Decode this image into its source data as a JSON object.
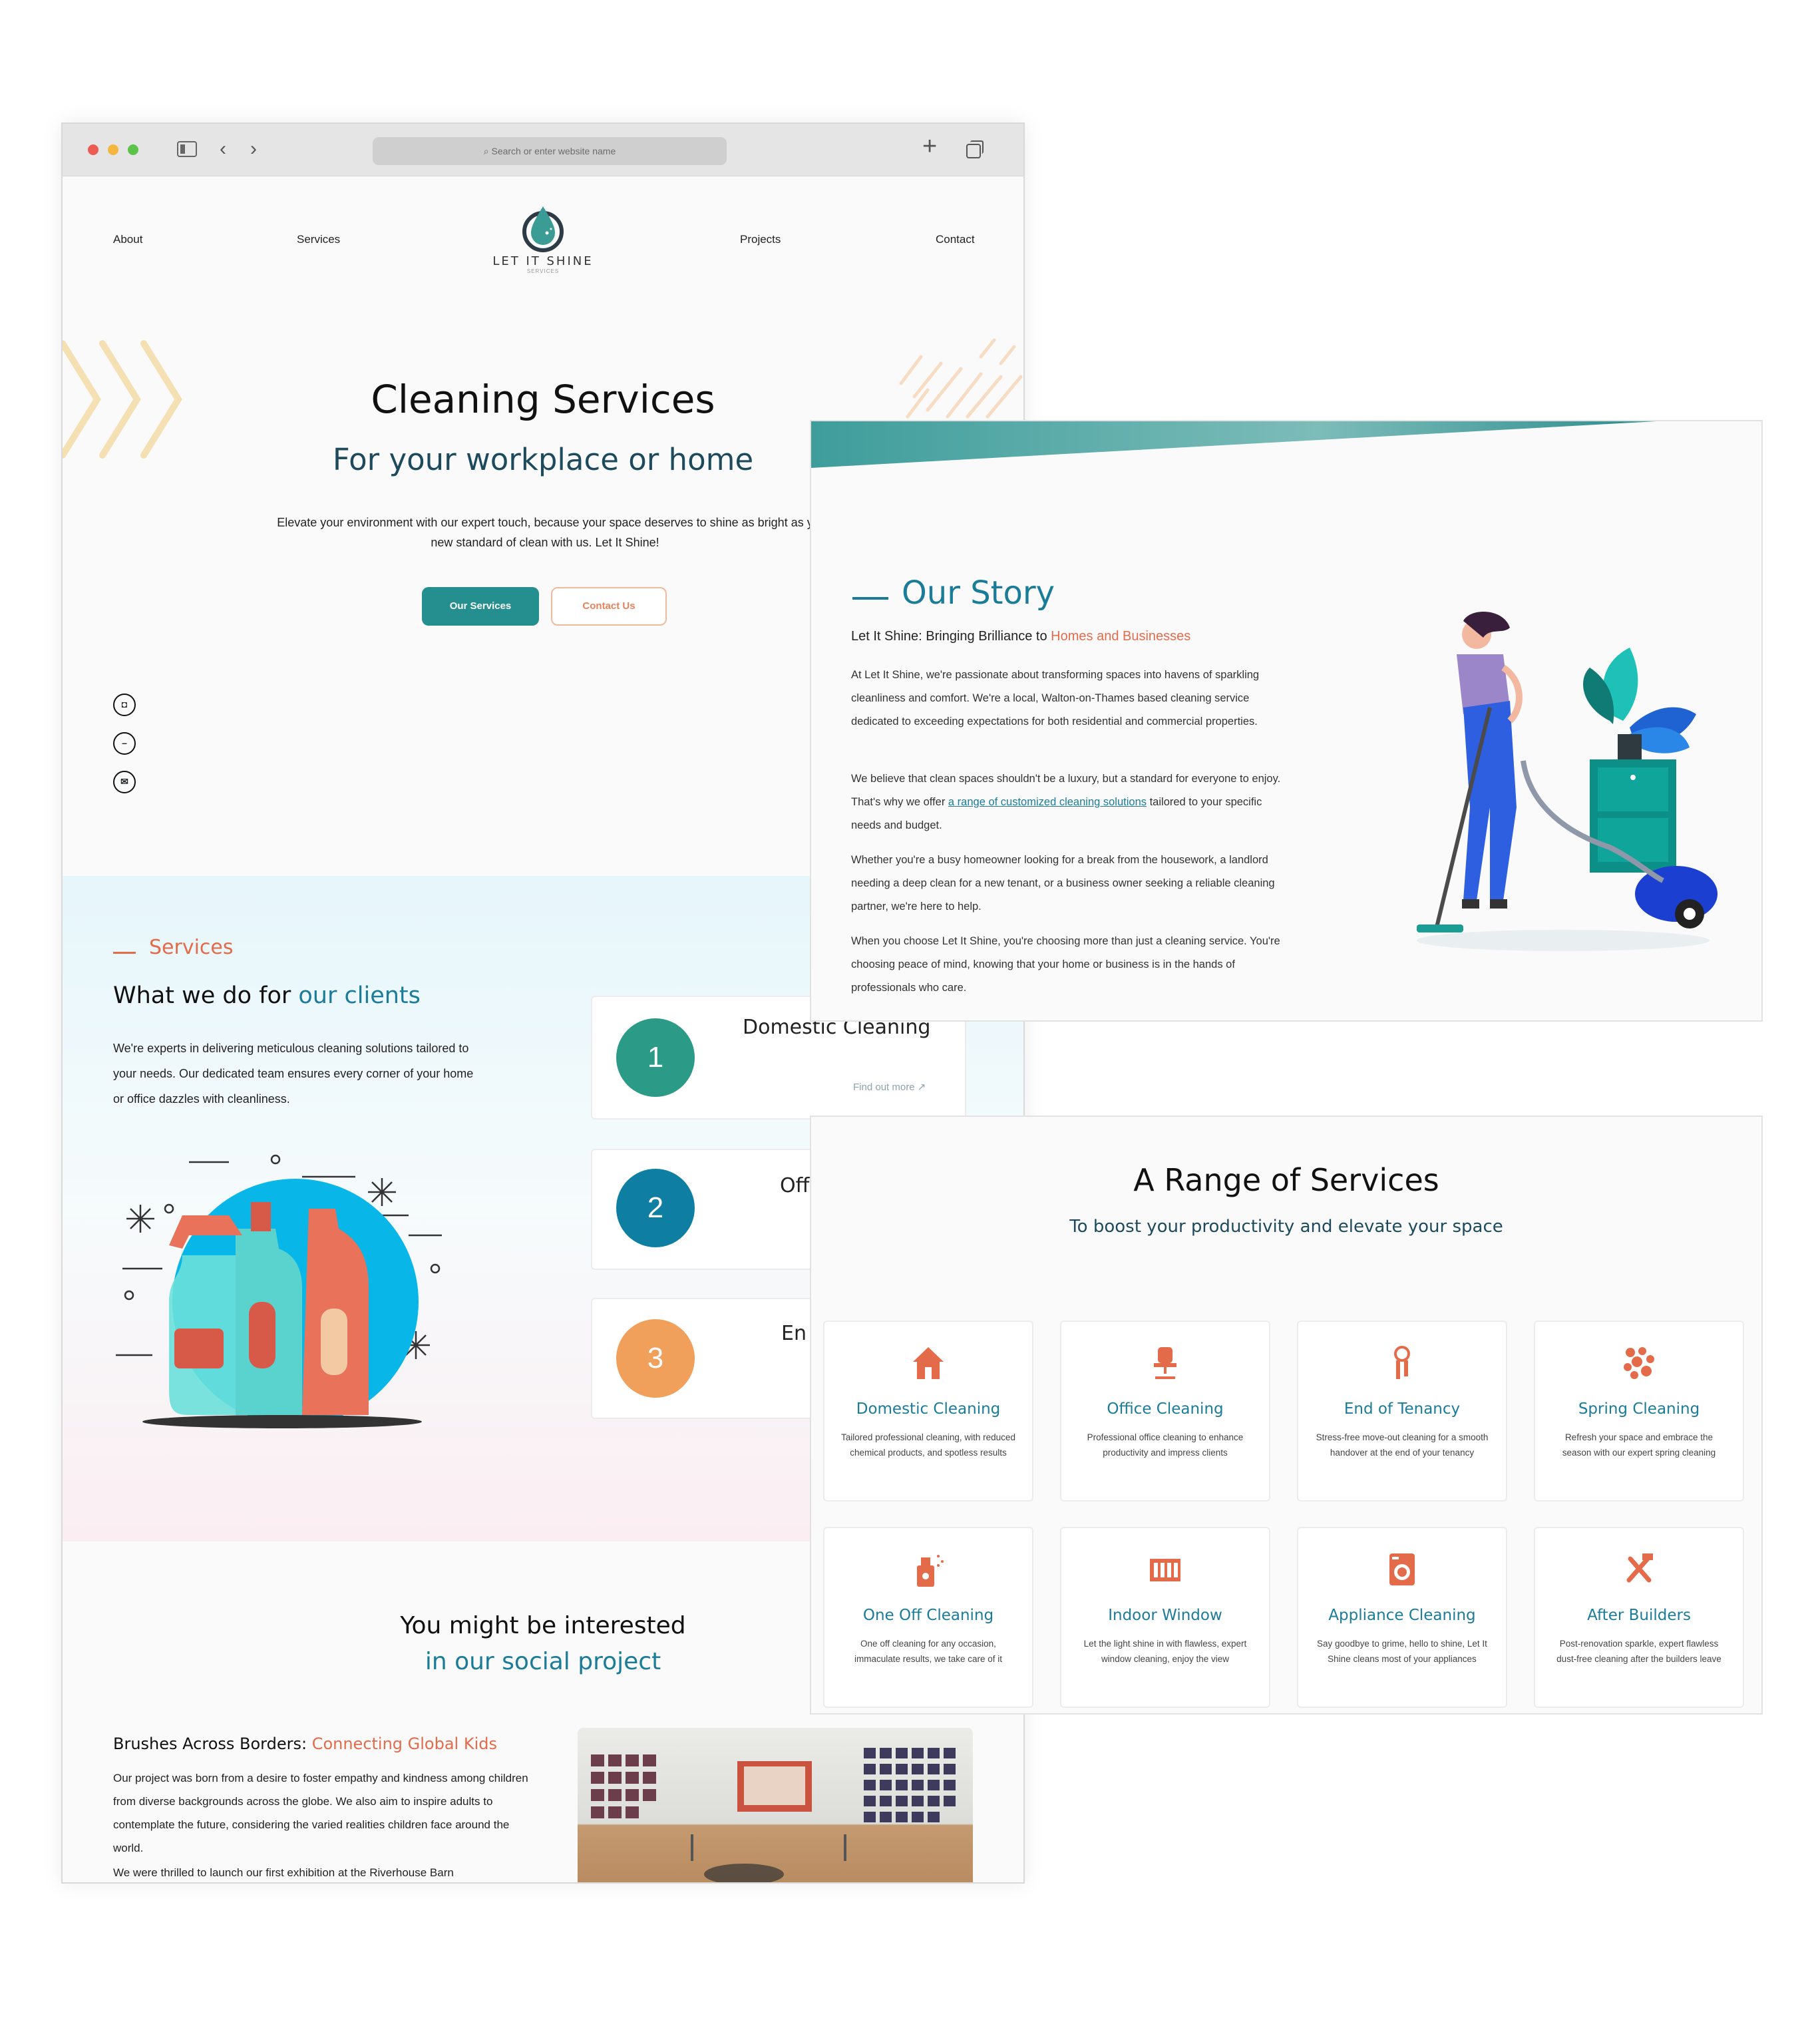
{
  "browser": {
    "url_placeholder": "Search or enter website name"
  },
  "nav": {
    "about": "About",
    "services": "Services",
    "projects": "Projects",
    "contact": "Contact",
    "logo_text": "LET IT SHINE",
    "logo_sub": "SERVICES"
  },
  "hero": {
    "title": "Cleaning Services",
    "subtitle": "For your workplace or home",
    "description": "Elevate your environment with our expert touch, because your space deserves to shine as bright as y\nnew standard of clean with us. Let It Shine!",
    "btn_services": "Our Services",
    "btn_contact": "Contact Us"
  },
  "services_section": {
    "tag": "Services",
    "heading_plain": "What we do for ",
    "heading_highlight": "our clients",
    "description": "We're experts in delivering meticulous cleaning solutions tailored to your needs. Our dedicated team ensures every corner of your home or office dazzles with cleanliness.",
    "cards": [
      {
        "number": "1",
        "title": "Domestic Cleaning",
        "link": "Find out more",
        "color": "#2b9a86"
      },
      {
        "number": "2",
        "title": "Off",
        "color": "#0f7ea3"
      },
      {
        "number": "3",
        "title": "En",
        "color": "#f0a05a"
      }
    ]
  },
  "social_project": {
    "title": "You might be interested",
    "subtitle": "in our social project",
    "project_title_plain": "Brushes Across Borders: ",
    "project_title_highlight": "Connecting Global Kids",
    "text": "Our project was born from a desire to foster empathy and kindness among children from diverse backgrounds across the globe. We also aim to inspire adults to contemplate the future, considering the varied realities children face around the world.",
    "text_cut": "We were thrilled to launch our first exhibition at the Riverhouse Barn"
  },
  "story": {
    "title": "Our Story",
    "subtitle_plain": "Let It Shine: Bringing Brilliance to ",
    "subtitle_highlight": "Homes and Businesses",
    "p1": "At Let It Shine, we're passionate about transforming spaces into havens of sparkling cleanliness and comfort. We're a local, Walton-on-Thames based cleaning service dedicated to exceeding expectations for both residential and commercial properties.",
    "p2_before": "We believe that clean spaces shouldn't be a luxury, but a standard for everyone to enjoy. That's why we offer ",
    "p2_link": "a range of customized cleaning solutions",
    "p2_after": " tailored to your specific needs and budget.",
    "p3": "Whether you're a busy homeowner looking for a break from the housework, a landlord needing a deep clean for a new tenant, or a business owner seeking a reliable cleaning partner, we're here to help.",
    "p4": "When you choose Let It Shine, you're choosing more than just a cleaning service. You're choosing peace of mind, knowing that your home or business is in the hands of professionals who care."
  },
  "range": {
    "title": "A Range of Services",
    "subtitle": "To boost your productivity and elevate your space",
    "items": [
      {
        "name": "Domestic Cleaning",
        "desc": "Tailored professional cleaning, with reduced chemical products, and spotless results",
        "icon": "house-icon"
      },
      {
        "name": "Office Cleaning",
        "desc": "Professional office cleaning to enhance productivity and impress clients",
        "icon": "office-chair-icon"
      },
      {
        "name": "End of Tenancy",
        "desc": "Stress-free move-out cleaning for a smooth handover at the end of your tenancy",
        "icon": "keys-icon"
      },
      {
        "name": "Spring Cleaning",
        "desc": "Refresh your space and embrace the season with our expert spring cleaning",
        "icon": "bubbles-icon"
      },
      {
        "name": "One Off Cleaning",
        "desc": "One off cleaning for any occasion, immaculate results, we take care of it",
        "icon": "spray-bottle-icon"
      },
      {
        "name": "Indoor Window",
        "desc": "Let the light shine in with flawless, expert window cleaning, enjoy the view",
        "icon": "window-icon"
      },
      {
        "name": "Appliance Cleaning",
        "desc": "Say goodbye to grime, hello to shine, Let It Shine cleans most of your appliances",
        "icon": "washing-machine-icon"
      },
      {
        "name": "After Builders",
        "desc": "Post-renovation sparkle, expert flawless dust-free cleaning after the builders leave",
        "icon": "tools-icon"
      }
    ]
  },
  "colors": {
    "teal": "#258f8f",
    "blue": "#1b7c9a",
    "coral": "#e46b4a",
    "orange": "#f0a05a"
  }
}
